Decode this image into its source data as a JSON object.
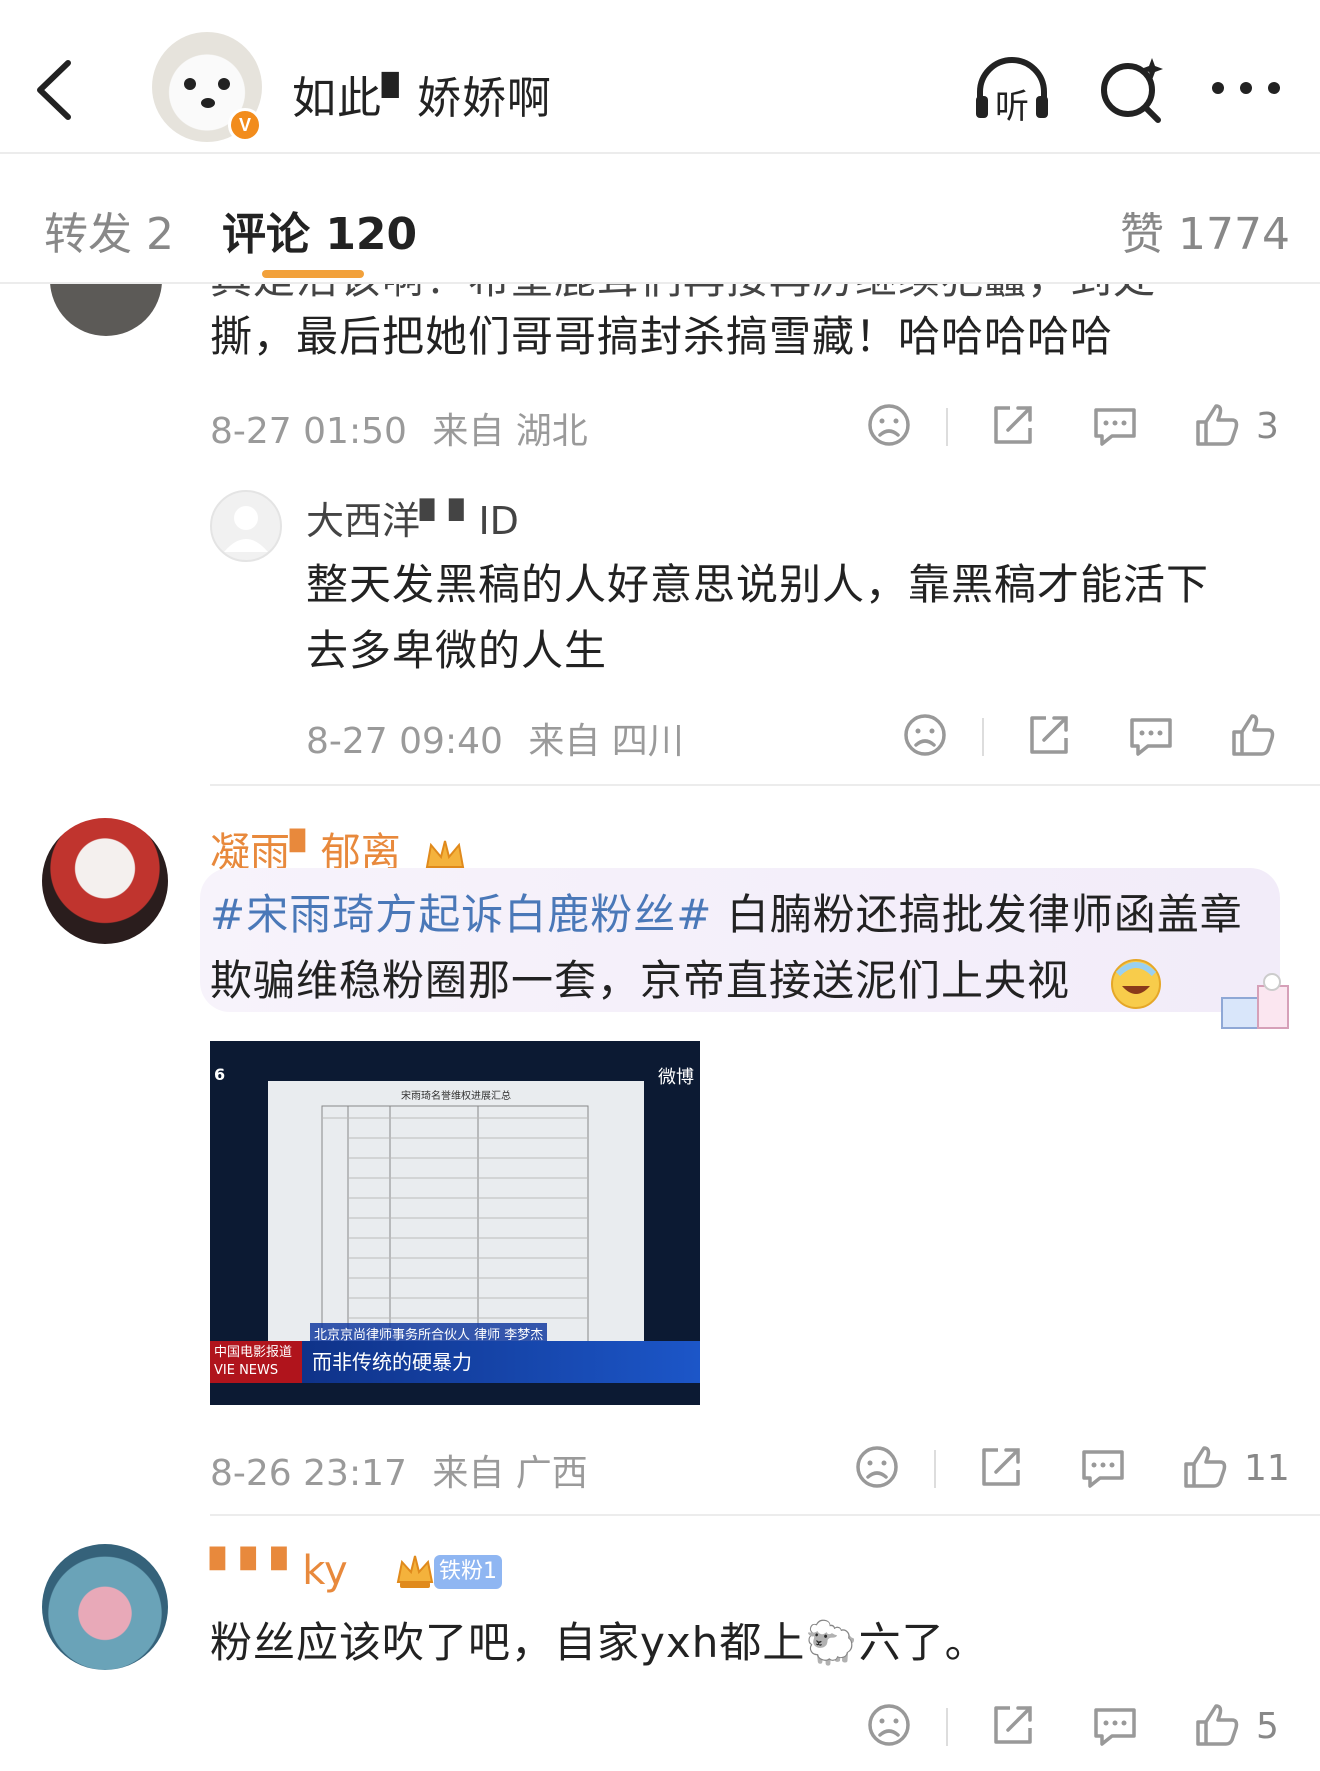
{
  "header": {
    "name": "如此▘娇娇啊",
    "listen_label": "听",
    "verified_badge": "V"
  },
  "tabs": {
    "repost": "转发 2",
    "comments": "评论 120",
    "likes": "赞 1774"
  },
  "comments": [
    {
      "text_line1": "真是活该啊！希望鹿茸们再接再厉继续犯蠢，到处",
      "text_line2": "撕，最后把她们哥哥搞封杀搞雪藏！哈哈哈哈哈",
      "time": "8-27 01:50",
      "location": "来自 湖北",
      "likes": "3"
    },
    {
      "user": "大西洋▘▘ID",
      "text_line1": "整天发黑稿的人好意思说别人，靠黑稿才能活下",
      "text_line2": "去多卑微的人生",
      "time": "8-27 09:40",
      "location": "来自 四川",
      "likes": ""
    },
    {
      "user": "凝雨▘郁离",
      "hashtag": "#宋雨琦方起诉白鹿粉丝#",
      "text_line1_rest": " 白腩粉还搞批发律师函盖章",
      "text_line2": "欺骗维稳粉圈那一套，京帝直接送泥们上央视",
      "time": "8-26 23:17",
      "location": "来自 广西",
      "likes": "11",
      "video": {
        "watermark": "微博",
        "channel": "6",
        "brand_top": "中国电影报道",
        "brand_bottom": "VIE NEWS",
        "caption_top": "北京京尚律师事务所合伙人 律师 李梦杰",
        "caption": "而非传统的硬暴力",
        "doc_title": "宋雨琦名誉维权进展汇总"
      }
    },
    {
      "user": "▘▘▘ky",
      "badge": "铁粉1",
      "text": "粉丝应该吹了吧，自家yxh都上🐑六了。",
      "likes": "5"
    }
  ],
  "colors": {
    "accent": "#f2a13b",
    "hashtag": "#4a78b8",
    "nickname": "#e8893c",
    "meta": "#9a9a9a"
  },
  "icons": [
    "back-arrow-icon",
    "listen-icon",
    "search-icon",
    "more-icon",
    "dislike-icon",
    "share-icon",
    "comment-icon",
    "like-icon",
    "crown-icon"
  ]
}
